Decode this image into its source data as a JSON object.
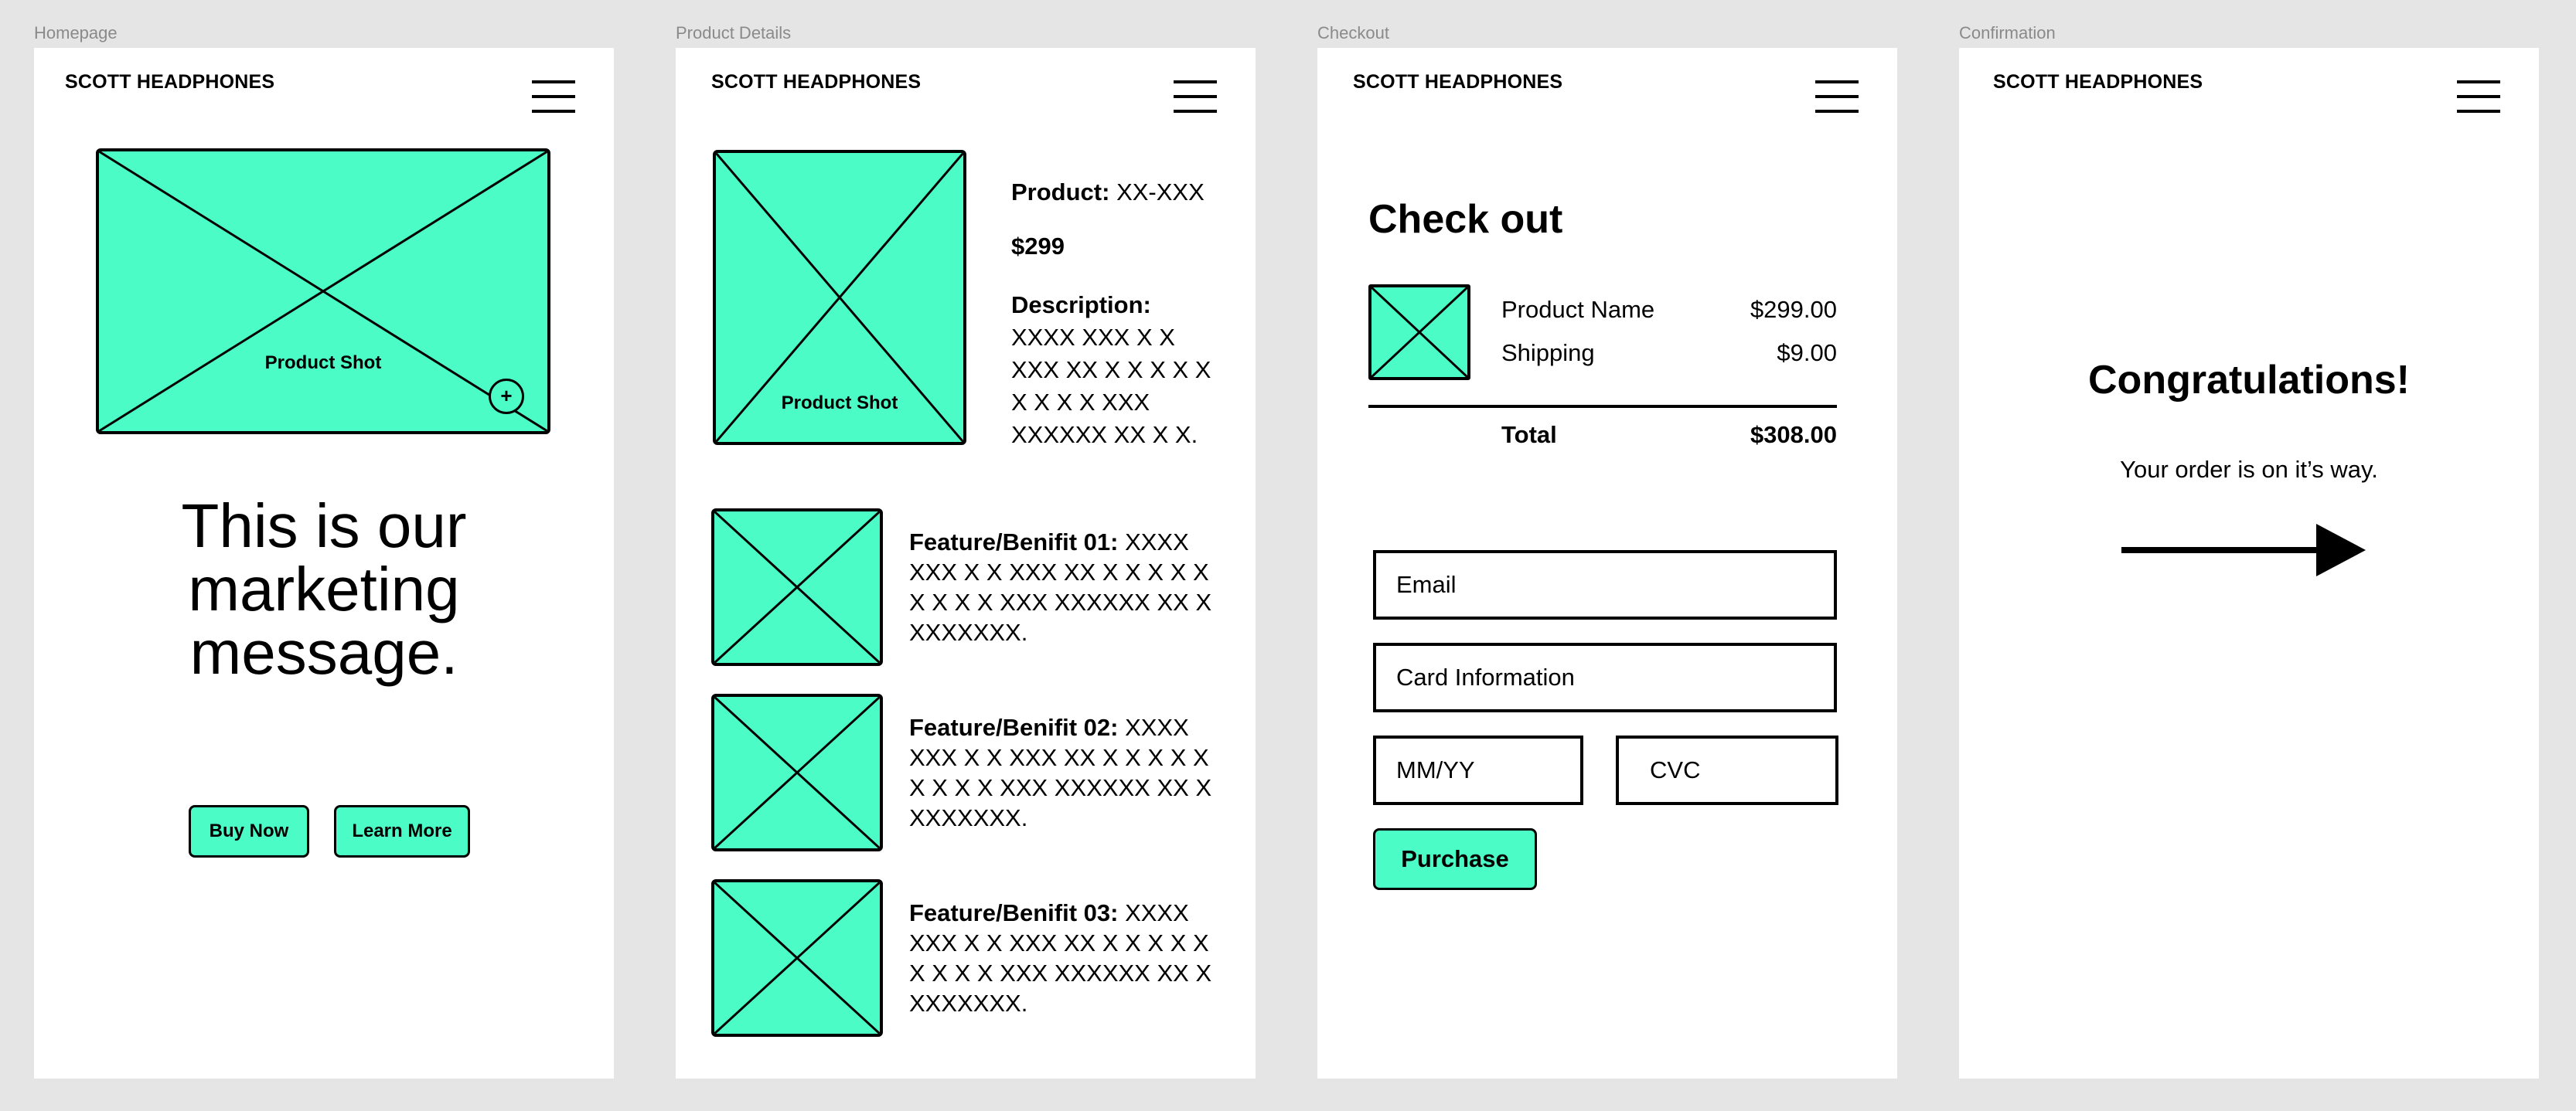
{
  "frames": [
    {
      "label": "Homepage"
    },
    {
      "label": "Product Details"
    },
    {
      "label": "Checkout"
    },
    {
      "label": "Confirmation"
    }
  ],
  "brand": "SCOTT HEADPHONES",
  "icons": {
    "menu": "hamburger-menu-icon",
    "zoom": "zoom-in-icon",
    "arrow": "arrow-right-icon",
    "placeholder": "image-placeholder-icon"
  },
  "colors": {
    "accent": "#4cfcc6",
    "background": "#e5e5e5",
    "frame": "#ffffff"
  },
  "homepage": {
    "product_shot_label": "Product Shot",
    "zoom_symbol": "+",
    "marketing_lines": [
      "This is our",
      "marketing",
      "message."
    ],
    "buy_now": "Buy Now",
    "learn_more": "Learn More"
  },
  "product": {
    "product_shot_label": "Product Shot",
    "product_key": "Product:",
    "product_value": "XX-XXX",
    "price": "$299",
    "description_key": "Description:",
    "description_lines": [
      "XXXX XXX X X",
      "XXX XX X X X X X",
      "X X X X XXX",
      "XXXXXX XX X X."
    ],
    "features": [
      {
        "key": "Feature/Benifit 01:",
        "lines": [
          "XXXX",
          "XXX X X XXX XX X X X X X",
          "X X X X XXX XXXXXX XX X",
          "XXXXXXX."
        ]
      },
      {
        "key": "Feature/Benifit 02:",
        "lines": [
          "XXXX",
          "XXX X X XXX XX X X X X X",
          "X X X X XXX XXXXXX XX X",
          "XXXXXXX."
        ]
      },
      {
        "key": "Feature/Benifit 03:",
        "lines": [
          "XXXX",
          "XXX X X XXX XX X X X X X",
          "X X X X XXX XXXXXX XX X",
          "XXXXXXX."
        ]
      }
    ]
  },
  "checkout": {
    "title": "Check out",
    "item_name": "Product Name",
    "item_price": "$299.00",
    "shipping_label": "Shipping",
    "shipping_price": "$9.00",
    "total_label": "Total",
    "total_price": "$308.00",
    "email_placeholder": "Email",
    "card_placeholder": "Card Information",
    "expiry_placeholder": "MM/YY",
    "cvc_placeholder": "CVC",
    "purchase": "Purchase"
  },
  "confirmation": {
    "title": "Congratulations!",
    "message": "Your order is on it’s way."
  }
}
